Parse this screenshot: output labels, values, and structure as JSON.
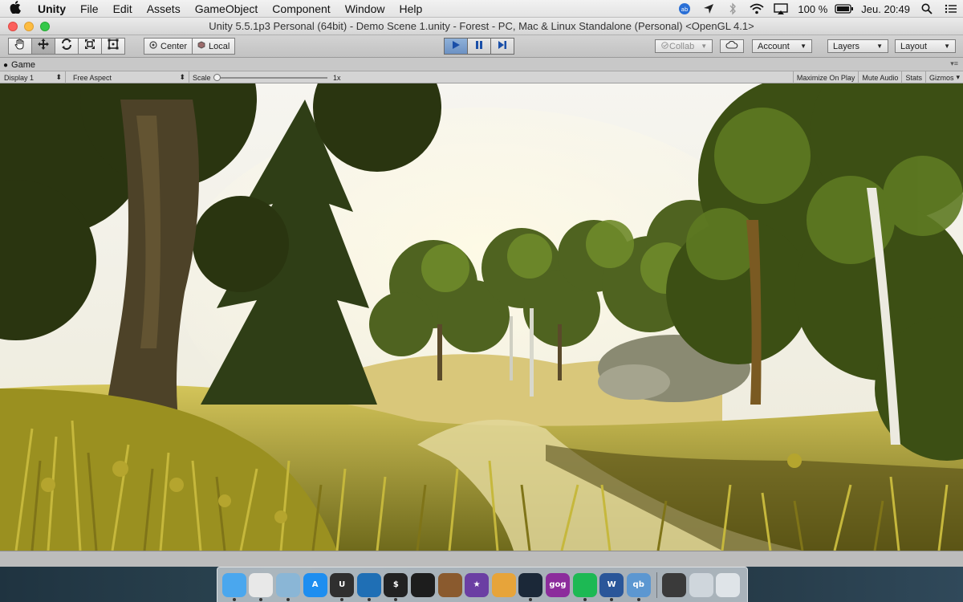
{
  "menubar": {
    "app_name": "Unity",
    "items": [
      "File",
      "Edit",
      "Assets",
      "GameObject",
      "Component",
      "Window",
      "Help"
    ],
    "battery": "100 %",
    "clock": "Jeu. 20:49"
  },
  "window": {
    "title": "Unity 5.5.1p3 Personal (64bit) - Demo Scene 1.unity - Forest - PC, Mac & Linux Standalone (Personal) <OpenGL 4.1>"
  },
  "toolbar": {
    "transform_tools": [
      "hand-icon",
      "move-icon",
      "rotate-icon",
      "scale-icon",
      "rect-tool-icon"
    ],
    "pivot_mode": "Center",
    "pivot_rotation": "Local",
    "play_state": "playing",
    "collab_label": "Collab",
    "account_label": "Account",
    "layers_label": "Layers",
    "layout_label": "Layout"
  },
  "game_view": {
    "tab_label": "Game",
    "display": "Display 1",
    "aspect": "Free Aspect",
    "scale_label": "Scale",
    "scale_value": "1x",
    "buttons": {
      "maximize": "Maximize On Play",
      "mute": "Mute Audio",
      "stats": "Stats",
      "gizmos": "Gizmos"
    }
  },
  "dock": {
    "apps": [
      {
        "name": "finder",
        "text": "",
        "color": "#4aa7ee",
        "running": true
      },
      {
        "name": "chrome",
        "text": "",
        "color": "#e8e8e8",
        "running": true
      },
      {
        "name": "preview",
        "text": "",
        "color": "#8ab6d6",
        "running": true
      },
      {
        "name": "app-store",
        "text": "A",
        "color": "#1e8ef0",
        "running": false
      },
      {
        "name": "unity",
        "text": "U",
        "color": "#2f2f2f",
        "running": true
      },
      {
        "name": "visual-studio-code",
        "text": "",
        "color": "#1f6fb5",
        "running": true
      },
      {
        "name": "terminal",
        "text": "$",
        "color": "#222222",
        "running": true
      },
      {
        "name": "guitar-pro",
        "text": "",
        "color": "#1d1d1d",
        "running": false
      },
      {
        "name": "garageband",
        "text": "",
        "color": "#8a5a2e",
        "running": false
      },
      {
        "name": "imovie",
        "text": "★",
        "color": "#6b3fa3",
        "running": false
      },
      {
        "name": "paint-app",
        "text": "",
        "color": "#e7a43a",
        "running": false
      },
      {
        "name": "steam",
        "text": "",
        "color": "#1b2838",
        "running": true
      },
      {
        "name": "gog-galaxy",
        "text": "gog",
        "color": "#8c2c9c",
        "running": false
      },
      {
        "name": "spotify",
        "text": "",
        "color": "#1db954",
        "running": true
      },
      {
        "name": "word",
        "text": "W",
        "color": "#2a5699",
        "running": true
      },
      {
        "name": "qbittorrent",
        "text": "qb",
        "color": "#5c97d1",
        "running": true
      },
      {
        "name": "screen-thumb",
        "text": "",
        "color": "#3a3a3a",
        "running": false
      },
      {
        "name": "download-stack",
        "text": "",
        "color": "#cfd6dc",
        "running": false
      },
      {
        "name": "trash",
        "text": "",
        "color": "#dfe4e8",
        "running": false
      }
    ]
  },
  "colors": {
    "play_blue": "#6c91c3",
    "foliage_dark": "#27330f",
    "foliage_mid": "#556a18",
    "grass_light": "#c8b83a",
    "sky": "#f4f2ea"
  }
}
